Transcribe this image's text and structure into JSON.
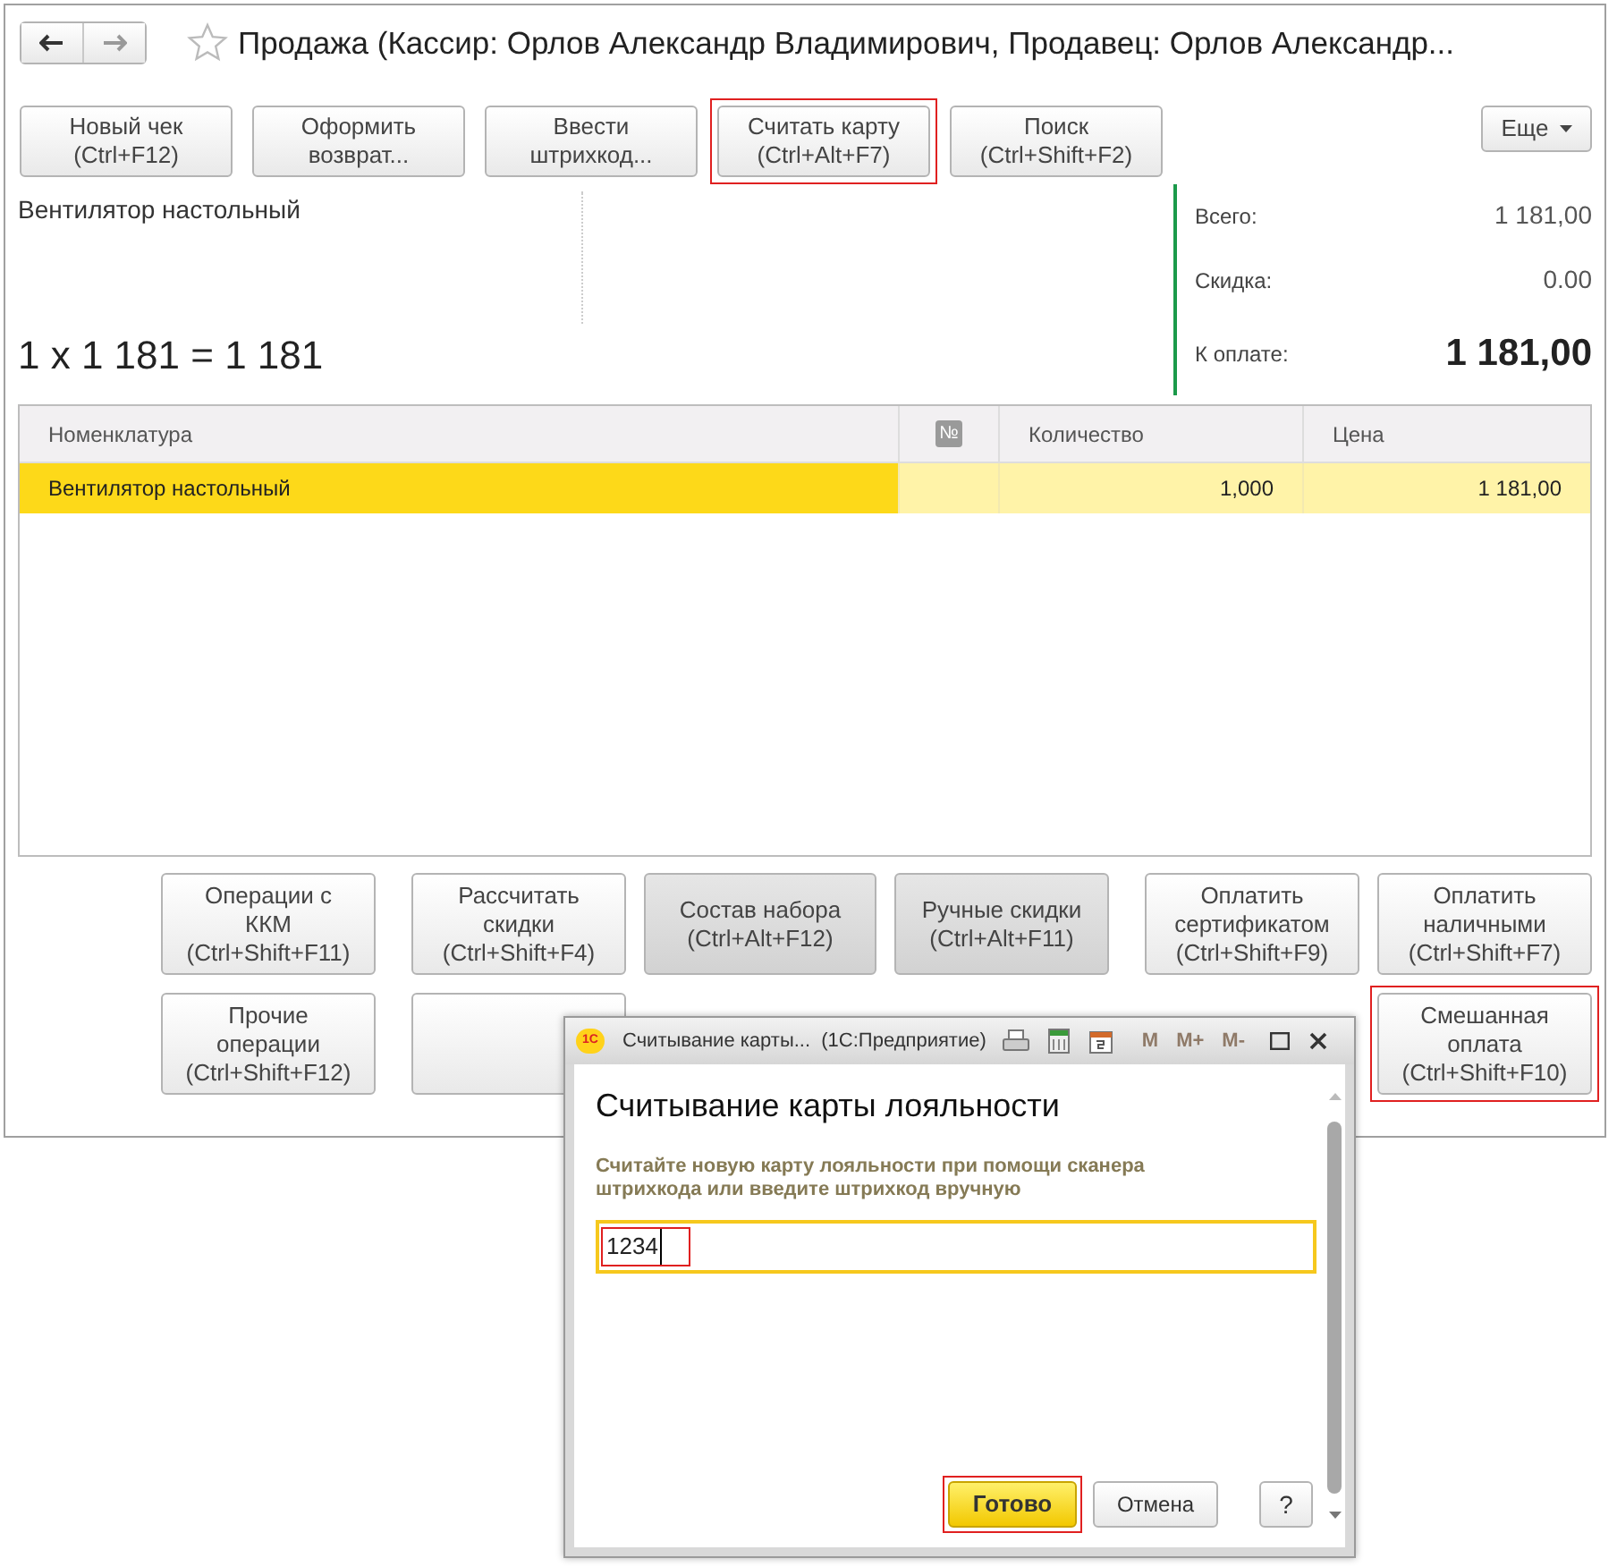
{
  "window": {
    "title": "Продажа (Кассир: Орлов Александр Владимирович, Продавец: Орлов Александр...",
    "favorite": false
  },
  "toolbar": [
    {
      "label": "Новый чек",
      "shortcut": "(Ctrl+F12)",
      "highlighted": false
    },
    {
      "label": "Оформить возврат...",
      "highlighted": false
    },
    {
      "label": "Ввести штрихкод...",
      "highlighted": false
    },
    {
      "label": "Считать карту",
      "shortcut": "(Ctrl+Alt+F7)",
      "highlighted": true
    },
    {
      "label": "Поиск",
      "shortcut": "(Ctrl+Shift+F2)",
      "highlighted": false
    }
  ],
  "more_button": "Еще",
  "current_item": {
    "name": "Вентилятор настольный",
    "formula": "1 x 1 181 = 1 181"
  },
  "totals": [
    {
      "label": "Всего:",
      "value": "1 181,00",
      "emphasis": false
    },
    {
      "label": "Скидка:",
      "value": "0.00",
      "emphasis": false
    },
    {
      "label": "К оплате:",
      "value": "1 181,00",
      "emphasis": true
    }
  ],
  "table": {
    "columns": [
      "Номенклатура",
      "№",
      "Количество",
      "Цена"
    ],
    "rows": [
      {
        "cells": [
          "Вентилятор настольный",
          "",
          "1,000",
          "1 181,00"
        ],
        "selected": true
      }
    ]
  },
  "actions": [
    [
      {
        "kind": "button",
        "label": "Операции с ККМ",
        "shortcut": "(Ctrl+Shift+F11)",
        "pressed": false,
        "highlighted": false
      },
      {
        "kind": "button",
        "label": "Рассчитать скидки",
        "shortcut": "(Ctrl+Shift+F4)",
        "pressed": false,
        "highlighted": false
      },
      {
        "kind": "button",
        "label": "Состав набора",
        "shortcut": "(Ctrl+Alt+F12)",
        "pressed": true,
        "highlighted": false
      },
      {
        "kind": "button",
        "label": "Ручные скидки",
        "shortcut": "(Ctrl+Alt+F11)",
        "pressed": true,
        "highlighted": false
      },
      {
        "kind": "button",
        "label": "Оплатить сертификатом",
        "shortcut": "(Ctrl+Shift+F9)",
        "pressed": false,
        "highlighted": false
      },
      {
        "kind": "button",
        "label": "Оплатить наличными",
        "shortcut": "(Ctrl+Shift+F7)",
        "pressed": false,
        "highlighted": false
      }
    ],
    [
      {
        "kind": "button",
        "label": "Прочие операции",
        "shortcut": "(Ctrl+Shift+F12)",
        "pressed": false,
        "highlighted": false
      },
      {
        "kind": "covered"
      },
      {
        "kind": "spacer"
      },
      {
        "kind": "spacer"
      },
      {
        "kind": "spacer"
      },
      {
        "kind": "button",
        "label": "Смешанная оплата",
        "shortcut": "(Ctrl+Shift+F10)",
        "pressed": false,
        "highlighted": true
      }
    ]
  ],
  "dialog": {
    "title": "Считывание карты...  (1С:Предприятие)",
    "logo": "1С",
    "memory_buttons": [
      "M",
      "M+",
      "M-"
    ],
    "heading": "Считывание карты лояльности",
    "instruction": "Считайте новую карту лояльности при помощи сканера штрихкода или введите штрихкод вручную",
    "input": {
      "value": "1234",
      "highlighted": true
    },
    "buttons": [
      {
        "label": "Готово",
        "kind": "primary",
        "highlighted": true
      },
      {
        "label": "Отмена",
        "kind": "normal",
        "highlighted": false
      },
      {
        "label": "?",
        "kind": "help",
        "highlighted": false
      }
    ]
  }
}
